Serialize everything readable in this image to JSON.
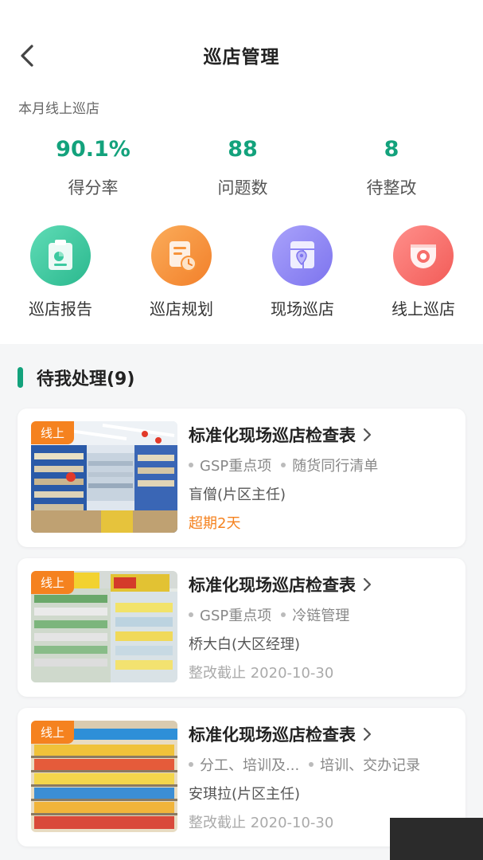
{
  "header": {
    "title": "巡店管理",
    "back_icon": "chevron-left-icon"
  },
  "subtitle": "本月线上巡店",
  "stats": [
    {
      "value": "90.1%",
      "label": "得分率"
    },
    {
      "value": "88",
      "label": "问题数"
    },
    {
      "value": "8",
      "label": "待整改"
    }
  ],
  "shortcuts": [
    {
      "label": "巡店报告",
      "icon": "report-clipboard-icon",
      "color": "#3cc9a0"
    },
    {
      "label": "巡店规划",
      "icon": "plan-clock-icon",
      "color": "#f7933a"
    },
    {
      "label": "现场巡店",
      "icon": "onsite-location-icon",
      "color": "#8e86f5"
    },
    {
      "label": "线上巡店",
      "icon": "camera-icon",
      "color": "#f66e6a"
    }
  ],
  "section": {
    "title": "待我处理(9)"
  },
  "tasks": [
    {
      "tag": "线上",
      "title": "标准化现场巡店检查表",
      "tags": [
        "GSP重点项",
        "随货同行清单"
      ],
      "person": "盲僧(片区主任)",
      "status": "超期2天",
      "status_color": "#f5821f"
    },
    {
      "tag": "线上",
      "title": "标准化现场巡店检查表",
      "tags": [
        "GSP重点项",
        "冷链管理"
      ],
      "person": "桥大白(大区经理)",
      "status": "整改截止 2020-10-30"
    },
    {
      "tag": "线上",
      "title": "标准化现场巡店检查表",
      "tags": [
        "分工、培训及...",
        "培训、交办记录"
      ],
      "person": "安琪拉(片区主任)",
      "status": "整改截止 2020-10-30"
    }
  ]
}
